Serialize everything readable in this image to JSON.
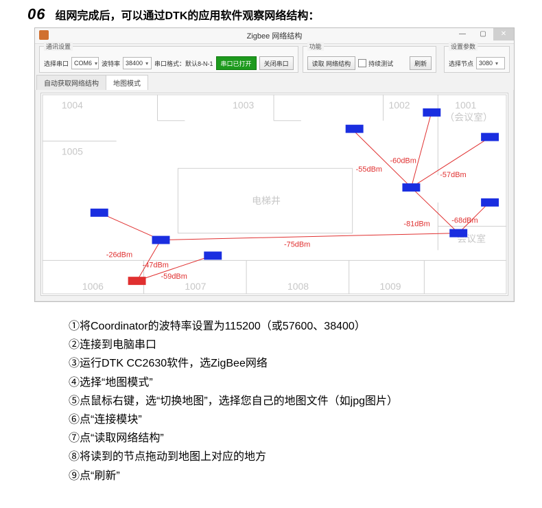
{
  "heading": {
    "number": "06",
    "text": "组网完成后，可以通过DTK的应用软件观察网络结构："
  },
  "window": {
    "title": "Zigbee 网络结构",
    "groups": {
      "comm": {
        "title": "通讯设置",
        "port_label": "选择串口",
        "port_value": "COM6",
        "baud_label": "波特率",
        "baud_value": "38400",
        "format_label": "串口格式：默认8-N-1",
        "btn_open": "串口已打开",
        "btn_close": "关闭串口"
      },
      "func": {
        "title": "功能",
        "btn_read": "读取 网络结构",
        "chk_cont": "持续测试",
        "btn_refresh": "刷新"
      },
      "param": {
        "title": "设置参数",
        "node_label": "选择节点",
        "node_value": "3080"
      }
    },
    "tabs": {
      "auto": "自动获取网络结构",
      "map": "地图模式"
    },
    "rooms": {
      "r1004": "1004",
      "r1003": "1003",
      "r1002": "1002",
      "r1001": "1001",
      "r1001sub": "（会议室）",
      "r1005": "1005",
      "center": "电梯井",
      "r1010sub": "会议室",
      "r1006": "1006",
      "r1007": "1007",
      "r1008": "1008",
      "r1009": "1009"
    },
    "dbm": {
      "d55": "-55dBm",
      "d60": "-60dBm",
      "d57": "-57dBm",
      "d81": "-81dBm",
      "d68": "-68dBm",
      "d75": "-75dBm",
      "d26": "-26dBm",
      "d47": "-47dBm",
      "d59": "-59dBm"
    }
  },
  "steps": {
    "s1": "①将Coordinator的波特率设置为115200（或57600、38400）",
    "s2": "②连接到电脑串口",
    "s3": "③运行DTK CC2630软件，选ZigBee网络",
    "s4": "④选择“地图模式”",
    "s5": "⑤点鼠标右键，选“切换地图”，选择您自己的地图文件（如jpg图片）",
    "s6": "⑥点“连接模块”",
    "s7": "⑦点“读取网络结构”",
    "s8": "⑧将读到的节点拖动到地图上对应的地方",
    "s9": "⑨点“刷新”"
  }
}
